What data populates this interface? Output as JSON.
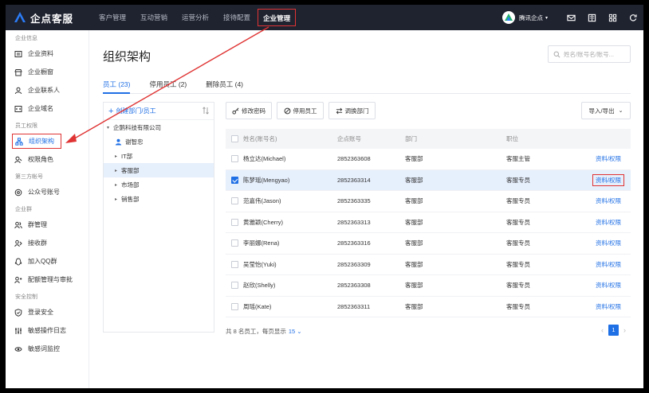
{
  "app": {
    "logo_text": "企点客服"
  },
  "topnav": {
    "items": [
      "客户管理",
      "互动营销",
      "运营分析",
      "接待配置",
      "企业管理"
    ],
    "active_index": 4,
    "org_name": "腾讯企点"
  },
  "sidebar": {
    "groups": [
      {
        "title": "企业信息",
        "items": [
          {
            "label": "企业资料",
            "icon": "id-card-icon"
          },
          {
            "label": "企业橱窗",
            "icon": "storefront-icon"
          },
          {
            "label": "企业联系人",
            "icon": "contact-icon"
          },
          {
            "label": "企业域名",
            "icon": "domain-icon"
          }
        ]
      },
      {
        "title": "员工权限",
        "items": [
          {
            "label": "组织架构",
            "icon": "org-chart-icon",
            "active": true
          },
          {
            "label": "权限角色",
            "icon": "role-icon"
          }
        ]
      },
      {
        "title": "第三方帐号",
        "items": [
          {
            "label": "公众号账号",
            "icon": "official-account-icon"
          }
        ]
      },
      {
        "title": "企业群",
        "items": [
          {
            "label": "群管理",
            "icon": "group-icon"
          },
          {
            "label": "接收群",
            "icon": "receive-group-icon"
          },
          {
            "label": "加入QQ群",
            "icon": "qq-group-icon"
          },
          {
            "label": "配额管理与审批",
            "icon": "quota-icon"
          }
        ]
      },
      {
        "title": "安全控制",
        "items": [
          {
            "label": "登录安全",
            "icon": "shield-icon"
          },
          {
            "label": "敏感操作日志",
            "icon": "log-icon"
          },
          {
            "label": "敏感词监控",
            "icon": "monitor-icon"
          }
        ]
      }
    ]
  },
  "main": {
    "title": "组织架构",
    "search_placeholder": "姓名/账号名/账号...",
    "tabs": [
      {
        "label": "员工 (23)",
        "active": true
      },
      {
        "label": "停用员工 (2)"
      },
      {
        "label": "删除员工 (4)"
      }
    ]
  },
  "tree": {
    "add_label": "创建部门/员工",
    "root": "企鹅科技有限公司",
    "person": "谢智忠",
    "departments": [
      "IT部",
      "客服部",
      "市场部",
      "销售部"
    ],
    "selected_index": 1
  },
  "toolbar": {
    "change_password": "修改密码",
    "disable_staff": "停用员工",
    "move_dept": "调换部门",
    "import_export": "导入/导出"
  },
  "table": {
    "headers": [
      "姓名(账号名)",
      "企点账号",
      "部门",
      "职位"
    ],
    "rows": [
      {
        "name": "杨立达(Michael)",
        "account": "2852363608",
        "dept": "客服部",
        "position": "客服主管",
        "op": "资料/权限",
        "checked": false
      },
      {
        "name": "陈梦瑶(Mengyao)",
        "account": "2852363314",
        "dept": "客服部",
        "position": "客服专员",
        "op": "资料/权限",
        "checked": true
      },
      {
        "name": "范嘉伟(Jason)",
        "account": "2852363335",
        "dept": "客服部",
        "position": "客服专员",
        "op": "资料/权限",
        "checked": false
      },
      {
        "name": "黄雅颖(Cherry)",
        "account": "2852363313",
        "dept": "客服部",
        "position": "客服专员",
        "op": "资料/权限",
        "checked": false
      },
      {
        "name": "李丽娜(Rena)",
        "account": "2852363316",
        "dept": "客服部",
        "position": "客服专员",
        "op": "资料/权限",
        "checked": false
      },
      {
        "name": "吴莹怡(Yuki)",
        "account": "2852363309",
        "dept": "客服部",
        "position": "客服专员",
        "op": "资料/权限",
        "checked": false
      },
      {
        "name": "赵欣(Shelly)",
        "account": "2852363308",
        "dept": "客服部",
        "position": "客服专员",
        "op": "资料/权限",
        "checked": false
      },
      {
        "name": "周瑶(Kate)",
        "account": "2852363311",
        "dept": "客服部",
        "position": "客服专员",
        "op": "资料/权限",
        "checked": false
      }
    ],
    "footer_text": "共 8 名员工，每页显示",
    "page_size": "15",
    "current_page": "1"
  }
}
